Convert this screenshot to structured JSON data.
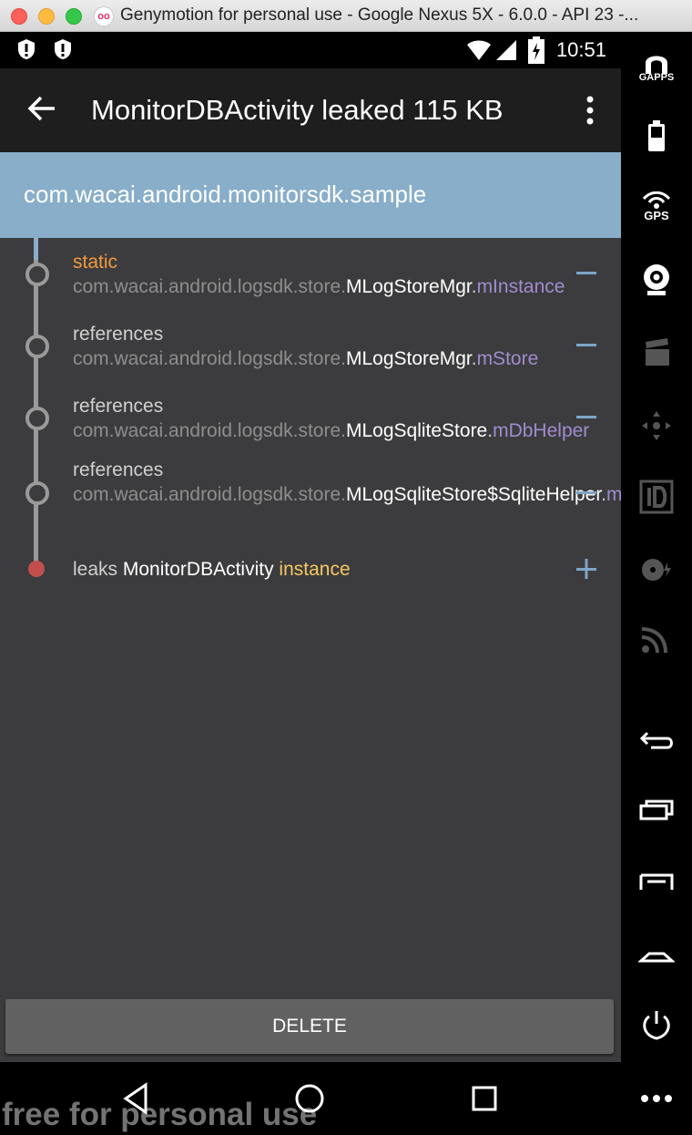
{
  "window": {
    "title": "Genymotion for personal use - Google Nexus 5X - 6.0.0 - API 23 -..."
  },
  "status_bar": {
    "time": "10:51"
  },
  "app_bar": {
    "title": "MonitorDBActivity leaked 115 KB"
  },
  "package_header": {
    "text": "com.wacai.android.monitorsdk.sample"
  },
  "leak_trace": [
    {
      "prefix": "static",
      "package": "com.wacai.android.logsdk.store.",
      "class": "MLogStoreMgr",
      "field": "mInstance",
      "toggle": "−"
    },
    {
      "prefix": "references",
      "package": "com.wacai.android.logsdk.store.",
      "class": "MLogStoreMgr",
      "field": "mStore",
      "toggle": "−"
    },
    {
      "prefix": "references",
      "package": "com.wacai.android.logsdk.store.",
      "class": "MLogSqliteStore",
      "field": "mDbHelper",
      "toggle": "−"
    },
    {
      "prefix": "references",
      "package": "com.wacai.android.logsdk.store.",
      "class": "MLogSqliteStore$SqliteHelper",
      "field": "mContext",
      "toggle": "−"
    },
    {
      "prefix": "leaks",
      "class": "MonitorDBActivity",
      "suffix": "instance",
      "toggle": "+"
    }
  ],
  "delete_button": {
    "label": "DELETE"
  },
  "watermark": "free for personal use",
  "sidebar": {
    "gapps_label": "GAPPS",
    "gps_label": "GPS"
  },
  "colors": {
    "package_bar": "#88aec9",
    "static_keyword": "#f29a3c",
    "field": "#a18ccf",
    "instance": "#f5c761",
    "leak_node": "#c34e4e"
  }
}
